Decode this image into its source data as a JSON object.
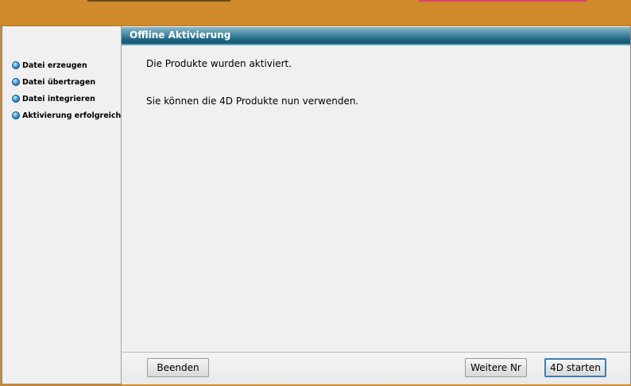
{
  "window": {
    "header_title": "Offline Aktivierung"
  },
  "sidebar": {
    "steps": [
      {
        "label": "Datei erzeugen"
      },
      {
        "label": "Datei übertragen"
      },
      {
        "label": "Datei integrieren"
      },
      {
        "label": "Aktivierung erfolgreich"
      }
    ]
  },
  "main": {
    "message_1": "Die Produkte wurden aktiviert.",
    "message_2": "Sie können die 4D Produkte nun verwenden."
  },
  "footer": {
    "quit_label": "Beenden",
    "next_label": "Weitere Nr",
    "start_label": "4D starten"
  },
  "colors": {
    "banner": "#cf8a2c",
    "header_bar": "#1e6583",
    "default_button_border": "#3c7fb1"
  }
}
